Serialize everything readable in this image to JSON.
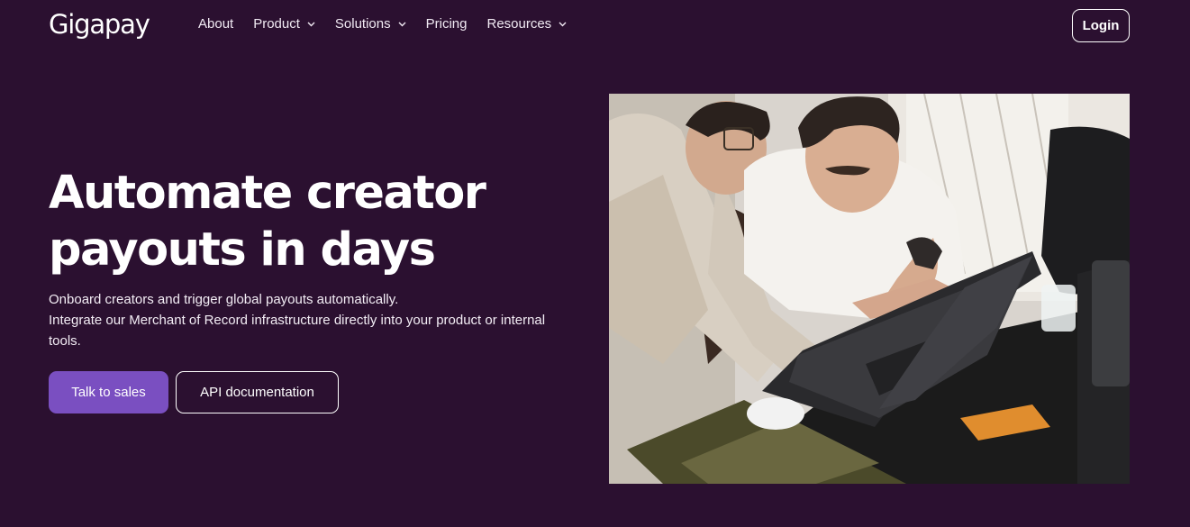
{
  "brand": {
    "logo_text": "Gigapay"
  },
  "nav": {
    "items": [
      {
        "label": "About",
        "has_dropdown": false
      },
      {
        "label": "Product",
        "has_dropdown": true
      },
      {
        "label": "Solutions",
        "has_dropdown": true
      },
      {
        "label": "Pricing",
        "has_dropdown": false
      },
      {
        "label": "Resources",
        "has_dropdown": true
      }
    ],
    "login_label": "Login"
  },
  "hero": {
    "headline_line1": "Automate creator",
    "headline_line2": "payouts in days",
    "subtext_line1": "Onboard creators and trigger global payouts automatically.",
    "subtext_line2": "Integrate our Merchant of Record infrastructure directly into your product or internal tools.",
    "primary_cta": "Talk to sales",
    "secondary_cta": "API documentation"
  },
  "colors": {
    "background": "#2b1030",
    "primary_button": "#7a4fc1",
    "text": "#ffffff"
  }
}
